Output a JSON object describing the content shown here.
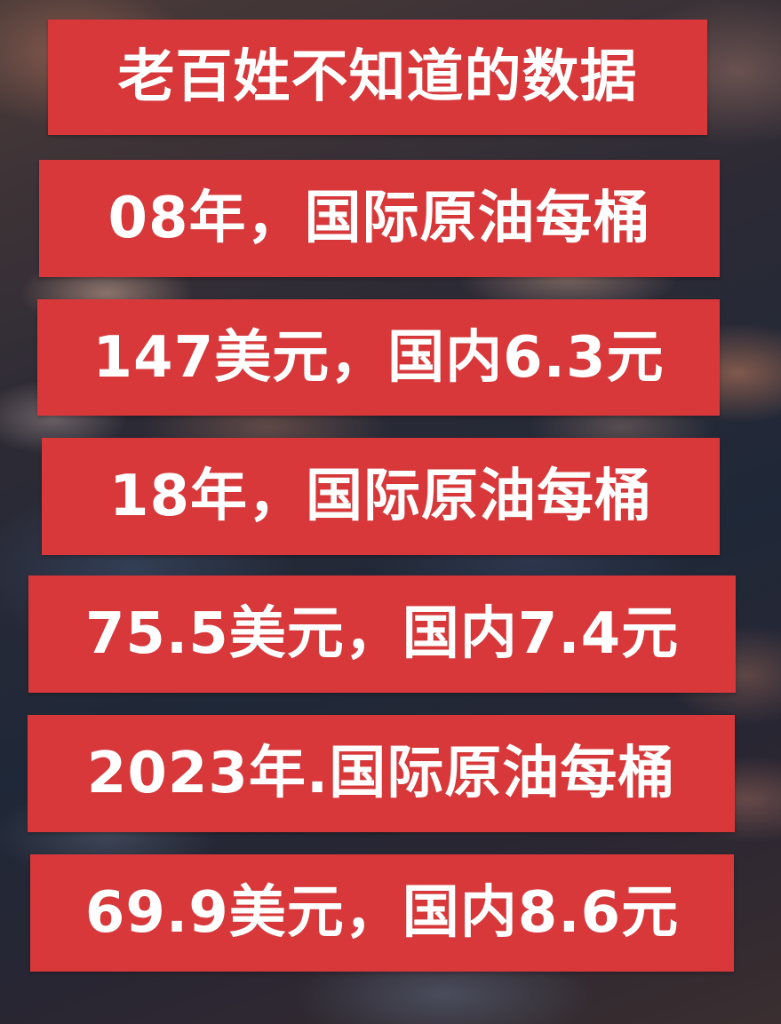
{
  "lines": [
    "老百姓不知道的数据",
    "08年，国际原油每桶",
    "147美元，国内6.3元",
    "18年，国际原油每桶",
    "75.5美元，国内7.4元",
    "2023年.国际原油每桶",
    "69.9美元，国内8.6元"
  ],
  "colors": {
    "banner": "#d9383a",
    "text": "#ffffff"
  }
}
